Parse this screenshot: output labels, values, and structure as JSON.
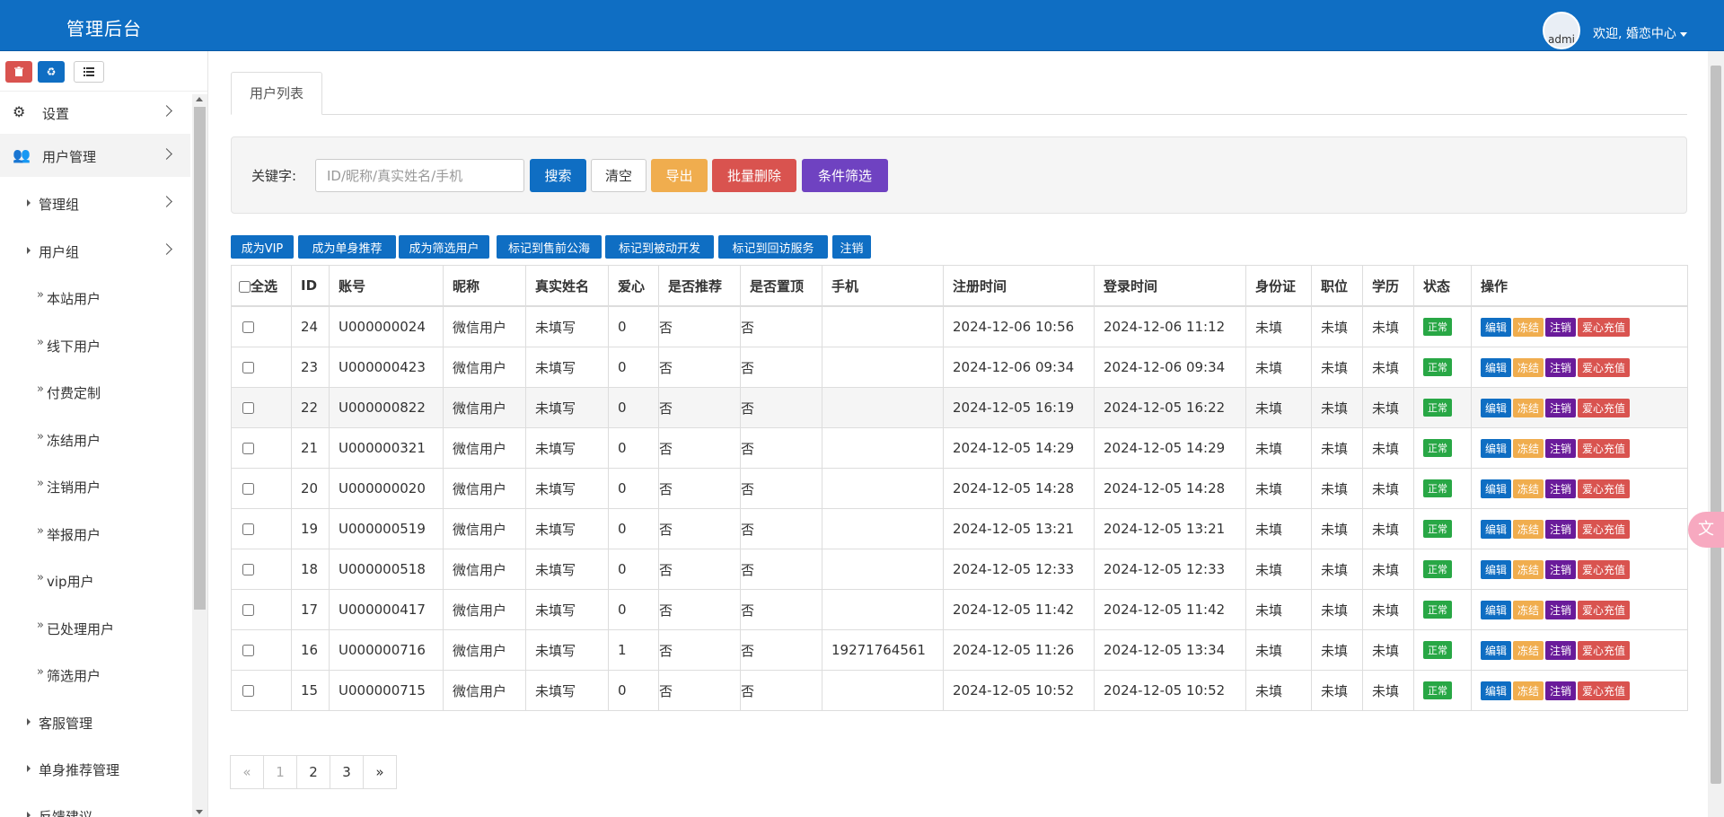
{
  "header": {
    "brand": "管理后台",
    "avatar_alt": "admi",
    "welcome": "欢迎, 婚恋中心"
  },
  "sidebar": {
    "tools": [
      "trash-icon",
      "recycle-icon",
      "list-icon"
    ],
    "items": [
      {
        "label": "设置",
        "level": 0,
        "icon": "gears-icon",
        "chevron": true,
        "active": false
      },
      {
        "label": "用户管理",
        "level": 0,
        "icon": "users-icon",
        "chevron": true,
        "active": true
      },
      {
        "label": "管理组",
        "level": 1,
        "chevron": true
      },
      {
        "label": "用户组",
        "level": 1,
        "chevron": true
      },
      {
        "label": "本站用户",
        "level": 2
      },
      {
        "label": "线下用户",
        "level": 2
      },
      {
        "label": "付费定制",
        "level": 2
      },
      {
        "label": "冻结用户",
        "level": 2
      },
      {
        "label": "注销用户",
        "level": 2
      },
      {
        "label": "举报用户",
        "level": 2
      },
      {
        "label": "vip用户",
        "level": 2
      },
      {
        "label": "已处理用户",
        "level": 2
      },
      {
        "label": "筛选用户",
        "level": 2
      },
      {
        "label": "客服管理",
        "level": 1
      },
      {
        "label": "单身推荐管理",
        "level": 1
      },
      {
        "label": "反馈建议",
        "level": 1
      }
    ]
  },
  "tab": {
    "label": "用户列表"
  },
  "search": {
    "label": "关键字:",
    "placeholder": "ID/昵称/真实姓名/手机",
    "value": "",
    "search_btn": "搜索",
    "clear_btn": "清空",
    "export_btn": "导出",
    "batch_delete_btn": "批量删除",
    "filter_btn": "条件筛选"
  },
  "actions": [
    "成为VIP",
    "成为单身推荐",
    "成为筛选用户",
    "标记到售前公海",
    "标记到被动开发",
    "标记到回访服务",
    "注销"
  ],
  "table": {
    "headers": {
      "select_all": "全选",
      "id": "ID",
      "account": "账号",
      "nickname": "昵称",
      "realname": "真实姓名",
      "love": "爱心",
      "recommend": "是否推荐",
      "top": "是否置顶",
      "phone": "手机",
      "reg_time": "注册时间",
      "login_time": "登录时间",
      "idcard": "身份证",
      "job": "职位",
      "edu": "学历",
      "status": "状态",
      "ops": "操作"
    },
    "rows": [
      {
        "id": "24",
        "account": "U000000024",
        "nickname": "微信用户",
        "realname": "未填写",
        "love": "0",
        "recommend": "否",
        "top": "否",
        "phone": "",
        "reg": "2024-12-06 10:56",
        "login": "2024-12-06 11:12",
        "idcard": "未填",
        "job": "未填",
        "edu": "未填",
        "status": "正常"
      },
      {
        "id": "23",
        "account": "U000000423",
        "nickname": "微信用户",
        "realname": "未填写",
        "love": "0",
        "recommend": "否",
        "top": "否",
        "phone": "",
        "reg": "2024-12-06 09:34",
        "login": "2024-12-06 09:34",
        "idcard": "未填",
        "job": "未填",
        "edu": "未填",
        "status": "正常"
      },
      {
        "id": "22",
        "account": "U000000822",
        "nickname": "微信用户",
        "realname": "未填写",
        "love": "0",
        "recommend": "否",
        "top": "否",
        "phone": "",
        "reg": "2024-12-05 16:19",
        "login": "2024-12-05 16:22",
        "idcard": "未填",
        "job": "未填",
        "edu": "未填",
        "status": "正常"
      },
      {
        "id": "21",
        "account": "U000000321",
        "nickname": "微信用户",
        "realname": "未填写",
        "love": "0",
        "recommend": "否",
        "top": "否",
        "phone": "",
        "reg": "2024-12-05 14:29",
        "login": "2024-12-05 14:29",
        "idcard": "未填",
        "job": "未填",
        "edu": "未填",
        "status": "正常"
      },
      {
        "id": "20",
        "account": "U000000020",
        "nickname": "微信用户",
        "realname": "未填写",
        "love": "0",
        "recommend": "否",
        "top": "否",
        "phone": "",
        "reg": "2024-12-05 14:28",
        "login": "2024-12-05 14:28",
        "idcard": "未填",
        "job": "未填",
        "edu": "未填",
        "status": "正常"
      },
      {
        "id": "19",
        "account": "U000000519",
        "nickname": "微信用户",
        "realname": "未填写",
        "love": "0",
        "recommend": "否",
        "top": "否",
        "phone": "",
        "reg": "2024-12-05 13:21",
        "login": "2024-12-05 13:21",
        "idcard": "未填",
        "job": "未填",
        "edu": "未填",
        "status": "正常"
      },
      {
        "id": "18",
        "account": "U000000518",
        "nickname": "微信用户",
        "realname": "未填写",
        "love": "0",
        "recommend": "否",
        "top": "否",
        "phone": "",
        "reg": "2024-12-05 12:33",
        "login": "2024-12-05 12:33",
        "idcard": "未填",
        "job": "未填",
        "edu": "未填",
        "status": "正常"
      },
      {
        "id": "17",
        "account": "U000000417",
        "nickname": "微信用户",
        "realname": "未填写",
        "love": "0",
        "recommend": "否",
        "top": "否",
        "phone": "",
        "reg": "2024-12-05 11:42",
        "login": "2024-12-05 11:42",
        "idcard": "未填",
        "job": "未填",
        "edu": "未填",
        "status": "正常"
      },
      {
        "id": "16",
        "account": "U000000716",
        "nickname": "微信用户",
        "realname": "未填写",
        "love": "1",
        "recommend": "否",
        "top": "否",
        "phone": "19271764561",
        "reg": "2024-12-05 11:26",
        "login": "2024-12-05 13:34",
        "idcard": "未填",
        "job": "未填",
        "edu": "未填",
        "status": "正常"
      },
      {
        "id": "15",
        "account": "U000000715",
        "nickname": "微信用户",
        "realname": "未填写",
        "love": "0",
        "recommend": "否",
        "top": "否",
        "phone": "",
        "reg": "2024-12-05 10:52",
        "login": "2024-12-05 10:52",
        "idcard": "未填",
        "job": "未填",
        "edu": "未填",
        "status": "正常"
      }
    ],
    "row_ops": [
      "编辑",
      "冻结",
      "注销",
      "爱心充值"
    ]
  },
  "pagination": [
    "«",
    "1",
    "2",
    "3",
    "»"
  ],
  "colors": {
    "primary": "#0f6ec3",
    "danger": "#d9534f",
    "warning": "#f0ad4e",
    "purple": "#6f42c1",
    "success": "#28a745"
  }
}
